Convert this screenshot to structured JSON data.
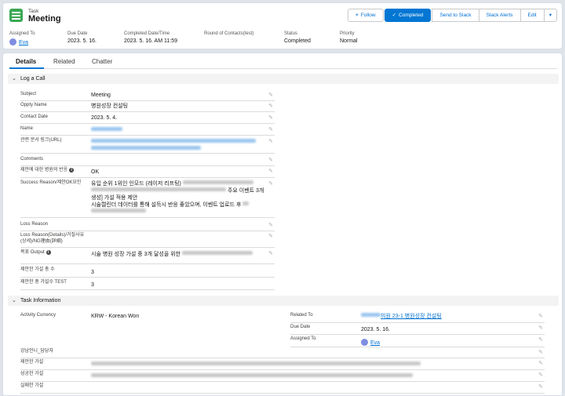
{
  "header": {
    "object_type": "Task",
    "title": "Meeting",
    "icon": "task-list-icon",
    "buttons": {
      "follow": "Follow",
      "completed": "Completed",
      "send_to_slack": "Send to Slack",
      "slack_alerts": "Slack Alerts",
      "edit": "Edit"
    },
    "fields": [
      {
        "label": "Assigned To",
        "value": "Eva"
      },
      {
        "label": "Due Date",
        "value": "2023. 5. 16."
      },
      {
        "label": "Completed Date/Time",
        "value": "2023. 5. 16. AM 11:59"
      },
      {
        "label": "Round of Contacts(test)",
        "value": ""
      },
      {
        "label": "Status",
        "value": "Completed"
      },
      {
        "label": "Priority",
        "value": "Normal"
      }
    ]
  },
  "tabs": [
    "Details",
    "Related",
    "Chatter"
  ],
  "sections": {
    "log_a_call": {
      "title": "Log a Call",
      "fields": {
        "subject": {
          "label": "Subject",
          "value": "Meeting"
        },
        "oppty_name": {
          "label": "Oppty Name",
          "value": "병원성장 컨설팅"
        },
        "contact_date": {
          "label": "Contact Date",
          "value": "2023. 5. 4."
        },
        "name": {
          "label": "Name",
          "value": ""
        },
        "doc_link": {
          "label": "관련 문서 링크(URL)",
          "value": ""
        },
        "comments": {
          "label": "Comments",
          "value": ""
        },
        "response": {
          "label": "제안에 대한 병원의 반응",
          "value": "OK"
        },
        "success_reason": {
          "label": "Success Reason/제안OK요인",
          "line1": "유입 순위 1위인 인모드 (레이저 리프팅)",
          "line2": "주요 이벤트 3개",
          "line3": "생성] 가설 적용 제안",
          "line4": "시술캘린더 데이터를 통해 설득시 반응 좋았으며, 이벤트 업로드 후"
        },
        "loss_reason": {
          "label": "Loss Reason",
          "value": ""
        },
        "loss_reason_details": {
          "label1": "Loss Reason(Details)/거절사유",
          "label2": "(상세)/NG理由(詳細)",
          "value": ""
        },
        "goal_output": {
          "label": "목표 Output",
          "value": "시술 병원 성장 가설 중 3개 달성을 위한"
        },
        "hypothesis_count": {
          "label": "제안한 가설 총 수",
          "value": "3"
        },
        "hypothesis_count_test": {
          "label": "제안한 총 가설수 TEST",
          "value": "3"
        }
      }
    },
    "task_information": {
      "title": "Task Information",
      "fields": {
        "activity_currency": {
          "label": "Activity Currency",
          "value": "KRW - Korean Won"
        },
        "related_to": {
          "label": "Related To",
          "value": "의원 23-1 병원성장 컨설팅"
        },
        "due_date": {
          "label": "Due Date",
          "value": "2023. 5. 16."
        },
        "assigned_to": {
          "label": "Assigned To",
          "value": "Eva"
        },
        "sales_manager": {
          "label": "강남언니_담당자",
          "value": ""
        },
        "proposed_hypothesis": {
          "label": "제안한 가설",
          "value": ""
        },
        "succeeded_hypothesis": {
          "label": "성공한 가설",
          "value": ""
        },
        "failed_hypothesis": {
          "label": "실패한 가설",
          "value": ""
        }
      }
    }
  },
  "colors": {
    "accent": "#0176d3",
    "task_icon": "#3ba755",
    "link": "#0070d2",
    "background": "#dfe4ea"
  }
}
